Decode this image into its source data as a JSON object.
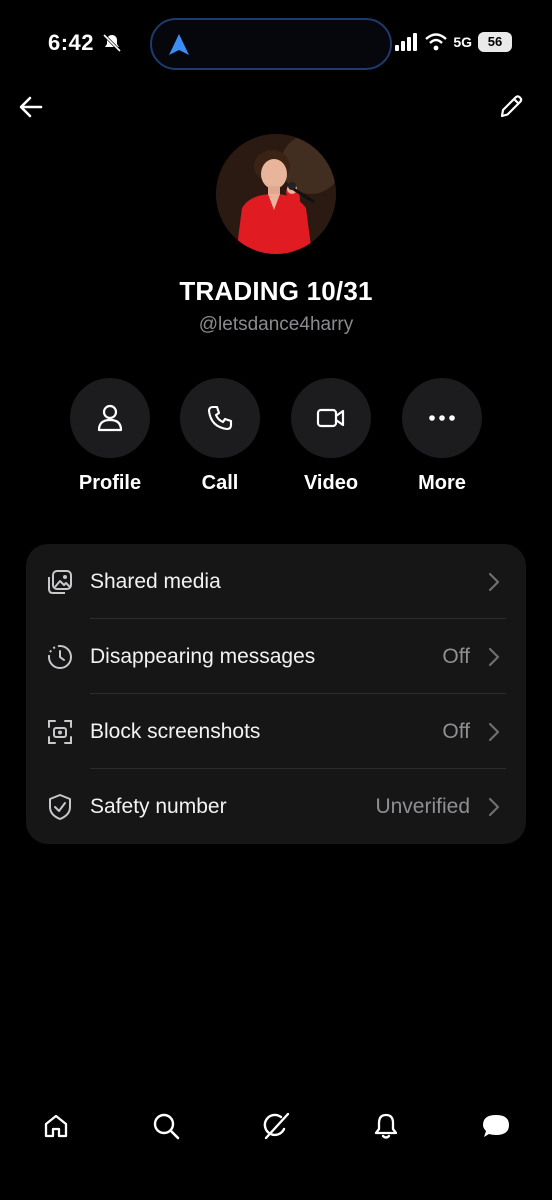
{
  "status_bar": {
    "time": "6:42",
    "network": "5G",
    "battery": "56"
  },
  "top_bar": {
    "back_icon": "arrow-left-icon",
    "edit_icon": "pencil-icon"
  },
  "profile": {
    "name": "TRADING 10/31",
    "handle": "@letsdance4harry"
  },
  "actions": [
    {
      "label": "Profile",
      "icon": "person-icon"
    },
    {
      "label": "Call",
      "icon": "phone-icon"
    },
    {
      "label": "Video",
      "icon": "video-icon"
    },
    {
      "label": "More",
      "icon": "ellipsis-icon"
    }
  ],
  "settings": [
    {
      "label": "Shared media",
      "value": "",
      "icon": "media-icon"
    },
    {
      "label": "Disappearing messages",
      "value": "Off",
      "icon": "timer-icon"
    },
    {
      "label": "Block screenshots",
      "value": "Off",
      "icon": "screenshot-icon"
    },
    {
      "label": "Safety number",
      "value": "Unverified",
      "icon": "shield-check-icon"
    }
  ],
  "bottom_nav": [
    {
      "icon": "home-icon"
    },
    {
      "icon": "search-icon"
    },
    {
      "icon": "grok-icon"
    },
    {
      "icon": "bell-icon"
    },
    {
      "icon": "chat-icon"
    }
  ],
  "colors": {
    "background": "#000000",
    "card": "#161617",
    "action_circle": "#1c1c1e",
    "secondary_text": "#8e8e93",
    "accent": "#1d9bf0"
  }
}
